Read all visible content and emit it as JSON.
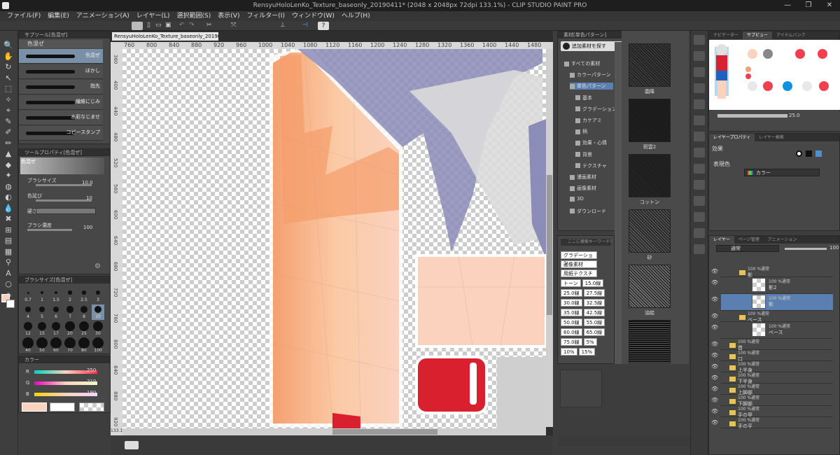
{
  "window": {
    "title": "RensyuHoloLenKo_Texture_baseonly_20190411* (2048 x 2048px 72dpi 133.1%) - CLIP STUDIO PAINT PRO"
  },
  "menu": [
    "ファイル(F)",
    "編集(E)",
    "アニメーション(A)",
    "レイヤー(L)",
    "選択範囲(S)",
    "表示(V)",
    "フィルター(I)",
    "ウィンドウ(W)",
    "ヘルプ(H)"
  ],
  "subtool": {
    "header": "サブツール[色混ぜ]",
    "tab": "色混ぜ",
    "items": [
      "色混ぜ",
      "ぼかし",
      "指先",
      "繊維にじみ",
      "水彩なじませ",
      "コピースタンプ"
    ]
  },
  "toolprop": {
    "header": "ツールプロパティ[色混ぜ]",
    "title": "色混ぜ",
    "brush_size_label": "ブラシサイズ",
    "brush_size": "10.0",
    "color_stretch_label": "色延び",
    "color_stretch": "10",
    "hardness_label": "硬さ",
    "density_label": "ブラシ濃度",
    "density": "100"
  },
  "brushsize": {
    "header": "ブラシサイズ[色混ぜ]",
    "sizes": [
      "0.7",
      "1",
      "1.5",
      "2",
      "2.5",
      "3",
      "4",
      "5",
      "6",
      "7",
      "8",
      "10",
      "12",
      "15",
      "17",
      "20",
      "25",
      "30",
      "40",
      "50",
      "60",
      "70",
      "80",
      "100"
    ]
  },
  "color": {
    "header": "カラー",
    "r_label": "R",
    "r": "250",
    "g_label": "G",
    "g": "210",
    "b_label": "B",
    "b": "190",
    "main": "#fad2be"
  },
  "canvas": {
    "tab": "RensyuHoloLenKo_Texture_baseonly_20190411*",
    "ruler_top": [
      "760",
      "800",
      "840",
      "880",
      "920",
      "960",
      "1000",
      "1040",
      "1080",
      "1120",
      "1160",
      "1200",
      "1240",
      "1280",
      "1320",
      "1360",
      "1400",
      "1440",
      "1480"
    ],
    "ruler_left": [
      "360",
      "400",
      "440",
      "480",
      "520",
      "560",
      "600",
      "640",
      "680",
      "720",
      "760",
      "800",
      "840",
      "880",
      "920"
    ],
    "zoom": "133.1"
  },
  "material": {
    "header": "素材[単色パターン]",
    "add_btn": "追加素材を探す",
    "tree": [
      "すべての素材",
      "カラーパターン",
      "単色パターン",
      "基本",
      "グラデーション",
      "カケアミ",
      "柄",
      "効果・心情",
      "背景",
      "テクスチャ",
      "漫画素材",
      "画像素材",
      "3D",
      "ダウンロード"
    ],
    "textures": [
      "霜降",
      "斑雲2",
      "コットン",
      "砂",
      "油絵"
    ],
    "search_placeholder": "ここに検索キーワードを入力",
    "tags": [
      "グラデーション",
      "画像素材",
      "用紙テクスチャ",
      "トーン",
      "15.0線",
      "25.0線",
      "27.5線",
      "30.0線",
      "32.5線",
      "35.0線",
      "42.5線",
      "50.0線",
      "55.0線",
      "60.0線",
      "65.0線",
      "75.0線",
      "5%",
      "10%",
      "15%"
    ]
  },
  "navigator": {
    "tabs": [
      "ナビゲーター",
      "サブビュー",
      "アイテムバンク"
    ],
    "zoom": "25.0"
  },
  "effect": {
    "tabs": [
      "レイヤープロパティ",
      "レイヤー検索"
    ],
    "title": "効果",
    "color_label": "表現色",
    "color_value": "カラー"
  },
  "layers": {
    "tabs": [
      "レイヤー",
      "ページ管理",
      "アニメーション"
    ],
    "blend": "通常",
    "opacity": "100",
    "items": [
      {
        "pct": "100 %通常",
        "name": "影",
        "kind": "folder"
      },
      {
        "pct": "100 %通常",
        "name": "影2",
        "kind": "thumb"
      },
      {
        "pct": "100 %通常",
        "name": "影",
        "kind": "thumb"
      },
      {
        "pct": "100 %通常",
        "name": "ベース",
        "kind": "folder"
      },
      {
        "pct": "100 %通常",
        "name": "ベース",
        "kind": "thumb"
      },
      {
        "pct": "100 %通常",
        "name": "首",
        "kind": "folder"
      },
      {
        "pct": "100 %通常",
        "name": "口",
        "kind": "folder"
      },
      {
        "pct": "100 %通常",
        "name": "上半身",
        "kind": "folder"
      },
      {
        "pct": "100 %通常",
        "name": "下半身",
        "kind": "folder"
      },
      {
        "pct": "100 %通常",
        "name": "上脚部",
        "kind": "folder"
      },
      {
        "pct": "100 %通常",
        "name": "下脚部",
        "kind": "folder"
      },
      {
        "pct": "100 %通常",
        "name": "手の甲",
        "kind": "folder"
      },
      {
        "pct": "100 %通常",
        "name": "手の平",
        "kind": "folder"
      }
    ]
  }
}
